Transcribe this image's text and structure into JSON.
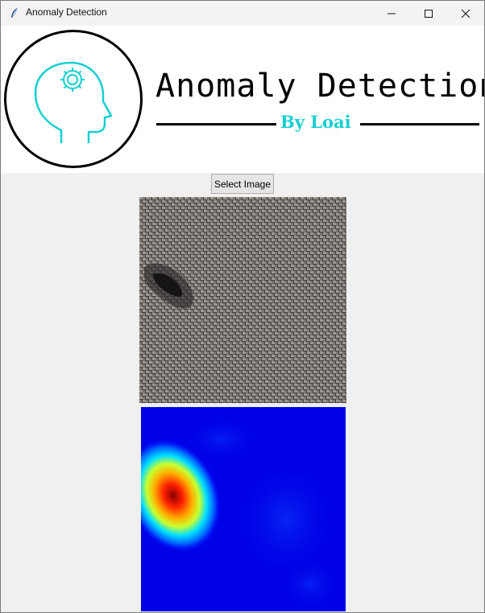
{
  "window": {
    "title": "Anomaly Detection",
    "icon": "tk-feather-icon",
    "controls": [
      "minimize-icon",
      "maximize-icon",
      "close-icon"
    ]
  },
  "banner": {
    "title": "Anomaly Detection",
    "byline": "By Loai",
    "logo_icon": "head-gear-icon",
    "colors": {
      "accent": "#16cfd0",
      "title": "#000000"
    }
  },
  "actions": {
    "select_image_label": "Select Image"
  },
  "images": {
    "input": "burlap-fabric-with-hole",
    "output": "anomaly-heatmap",
    "heatmap_colors": {
      "low": "#0000ff",
      "high": "#8b0000"
    }
  }
}
